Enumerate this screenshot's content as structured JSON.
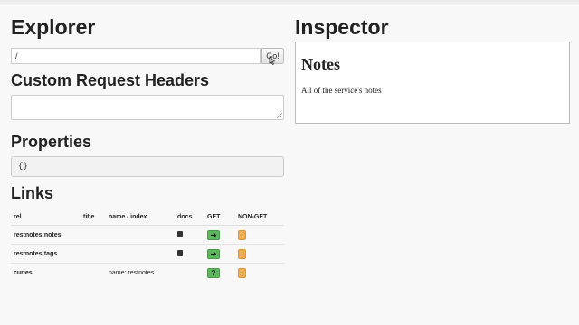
{
  "explorer": {
    "title": "Explorer",
    "url_value": "/",
    "go_label": "Go!",
    "headers_title": "Custom Request Headers",
    "headers_value": "",
    "properties_title": "Properties",
    "properties_value": "{}",
    "links_title": "Links",
    "links_table": {
      "headers": [
        "rel",
        "title",
        "name / index",
        "docs",
        "GET",
        "NON-GET"
      ],
      "rows": [
        {
          "rel": "restnotes:notes",
          "title": "",
          "name": "",
          "docs": true,
          "get": "arrow",
          "nonget": "!"
        },
        {
          "rel": "restnotes:tags",
          "title": "",
          "name": "",
          "docs": true,
          "get": "arrow",
          "nonget": "!"
        },
        {
          "rel": "curies",
          "title": "",
          "name": "name: restnotes",
          "docs": false,
          "get": "query",
          "nonget": "!"
        }
      ]
    }
  },
  "inspector": {
    "title": "Inspector",
    "doc_title": "Notes",
    "doc_text": "All of the service's notes"
  },
  "colors": {
    "get_button": "#5cb85c",
    "nonget_button": "#f0ad4e",
    "background": "#f8f8f8"
  },
  "icons": {
    "docs": "book-icon",
    "get": "arrow-right-icon",
    "get_query": "question-icon",
    "nonget": "exclamation-icon"
  }
}
